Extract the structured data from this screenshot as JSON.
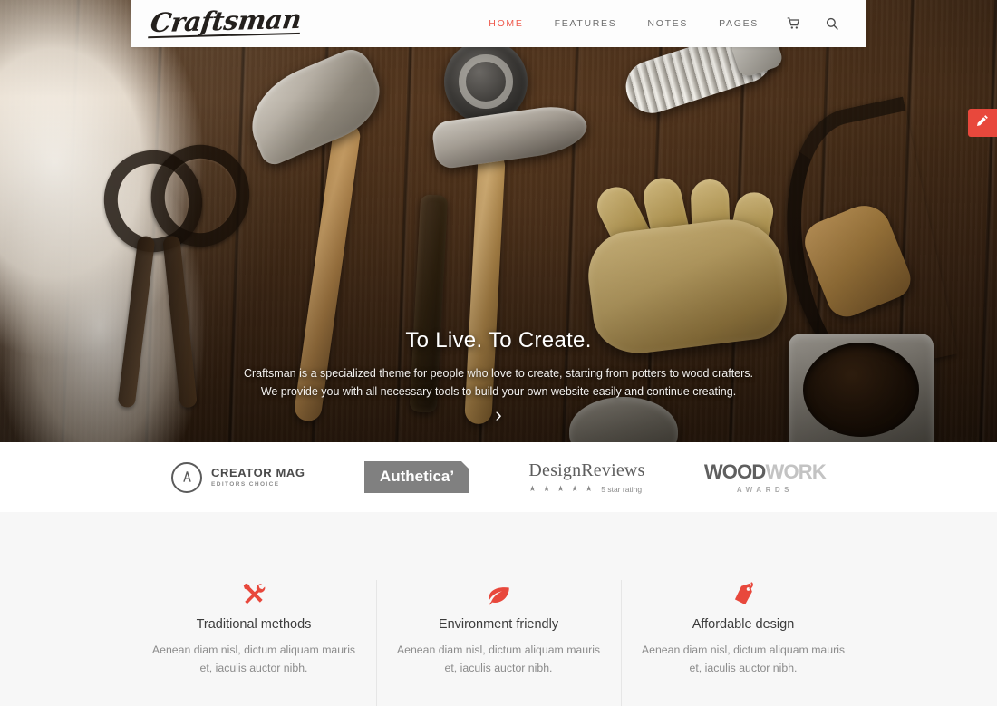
{
  "header": {
    "logo_text": "Craftsman",
    "nav": [
      {
        "label": "HOME",
        "active": true
      },
      {
        "label": "FEATURES",
        "active": false
      },
      {
        "label": "NOTES",
        "active": false
      },
      {
        "label": "PAGES",
        "active": false
      }
    ],
    "cart_icon": "shopping-cart-icon",
    "search_icon": "search-icon"
  },
  "hero": {
    "title": "To Live. To Create.",
    "subtitle_line1": "Craftsman is a specialized theme for people who love to create, starting from potters to wood crafters.",
    "subtitle_line2": "We provide you with all necessary tools to build your own website easily and continue creating.",
    "scroll_arrow": "›"
  },
  "edit_tab": {
    "icon": "pencil-icon",
    "color": "#e8483c"
  },
  "brands": [
    {
      "name": "CREATOR MAG",
      "tagline": "EDITORS CHOICE",
      "icon": "compass-circle-icon"
    },
    {
      "name": "Authetica’"
    },
    {
      "name": "DesignReviews",
      "stars": "★ ★ ★ ★ ★",
      "rating_text": "5 star rating"
    },
    {
      "name_dark": "WOOD",
      "name_light": "WORK",
      "tagline": "AWARDS"
    }
  ],
  "features": [
    {
      "icon": "hammer-wrench-icon",
      "title": "Traditional methods",
      "desc": "Aenean diam nisl, dictum aliquam mauris et, iaculis auctor nibh."
    },
    {
      "icon": "leaf-icon",
      "title": "Environment friendly",
      "desc": "Aenean diam nisl, dictum aliquam mauris et, iaculis auctor nibh."
    },
    {
      "icon": "price-tag-icon",
      "title": "Affordable design",
      "desc": "Aenean diam nisl, dictum aliquam mauris et, iaculis auctor nibh."
    }
  ],
  "colors": {
    "accent": "#e8483c",
    "nav_active": "#ef5a4d",
    "section_bg": "#f7f7f7",
    "heading": "#3c3c3c",
    "body_text": "#8b8b8b"
  }
}
